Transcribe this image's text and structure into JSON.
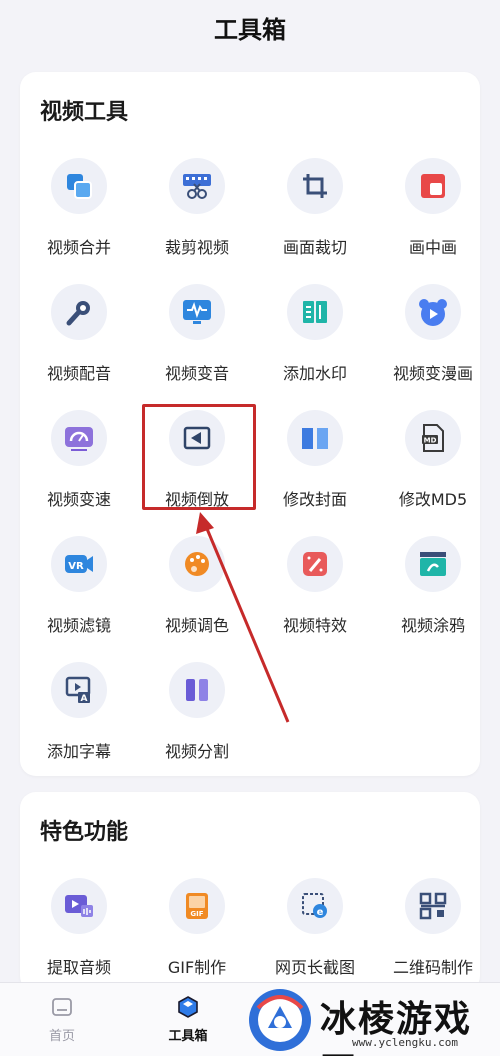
{
  "header": {
    "title": "工具箱"
  },
  "video_tools": {
    "title": "视频工具",
    "items": [
      {
        "label": "视频合并",
        "icon": "merge-icon",
        "color": "#2e86de"
      },
      {
        "label": "裁剪视频",
        "icon": "scissors-icon",
        "color": "#3d6fd6"
      },
      {
        "label": "画面裁切",
        "icon": "crop-icon",
        "color": "#3a4f78"
      },
      {
        "label": "画中画",
        "icon": "picture-in-picture-icon",
        "color": "#e84848"
      },
      {
        "label": "视频配音",
        "icon": "microphone-icon",
        "color": "#3a4f78"
      },
      {
        "label": "视频变音",
        "icon": "waveform-monitor-icon",
        "color": "#2e86de"
      },
      {
        "label": "添加水印",
        "icon": "watermark-icon",
        "color": "#1fb5a8"
      },
      {
        "label": "视频变漫画",
        "icon": "bear-play-icon",
        "color": "#4a7df0"
      },
      {
        "label": "视频变速",
        "icon": "speedometer-icon",
        "color": "#7b5cd6"
      },
      {
        "label": "视频倒放",
        "icon": "reverse-play-icon",
        "color": "#2f4468"
      },
      {
        "label": "修改封面",
        "icon": "book-icon",
        "color": "#3d7be0"
      },
      {
        "label": "修改MD5",
        "icon": "md-file-icon",
        "color": "#3a3a3a"
      },
      {
        "label": "视频滤镜",
        "icon": "vr-camera-icon",
        "color": "#2e86de"
      },
      {
        "label": "视频调色",
        "icon": "palette-icon",
        "color": "#f08a24"
      },
      {
        "label": "视频特效",
        "icon": "magic-wand-icon",
        "color": "#e85a5a"
      },
      {
        "label": "视频涂鸦",
        "icon": "clapper-brush-icon",
        "color": "#1fb5a8"
      },
      {
        "label": "添加字幕",
        "icon": "subtitle-icon",
        "color": "#3a4f78"
      },
      {
        "label": "视频分割",
        "icon": "split-icon",
        "color": "#6a5cd6"
      }
    ]
  },
  "special_features": {
    "title": "特色功能",
    "items": [
      {
        "label": "提取音频",
        "icon": "audio-extract-icon",
        "color": "#6a5cd6"
      },
      {
        "label": "GIF制作",
        "icon": "gif-icon",
        "color": "#f08a24"
      },
      {
        "label": "网页长截图",
        "icon": "web-screenshot-icon",
        "color": "#2e86de"
      },
      {
        "label": "二维码制作",
        "icon": "qr-code-icon",
        "color": "#3a4f78"
      }
    ]
  },
  "bottom_nav": {
    "items": [
      {
        "label": "首页",
        "icon": "home-icon",
        "active": false
      },
      {
        "label": "工具箱",
        "icon": "toolbox-icon",
        "active": true
      }
    ]
  },
  "watermark": {
    "text": "冰棱游戏网",
    "url": "www.yclengku.com"
  },
  "annotation_color": "#c62a2a"
}
